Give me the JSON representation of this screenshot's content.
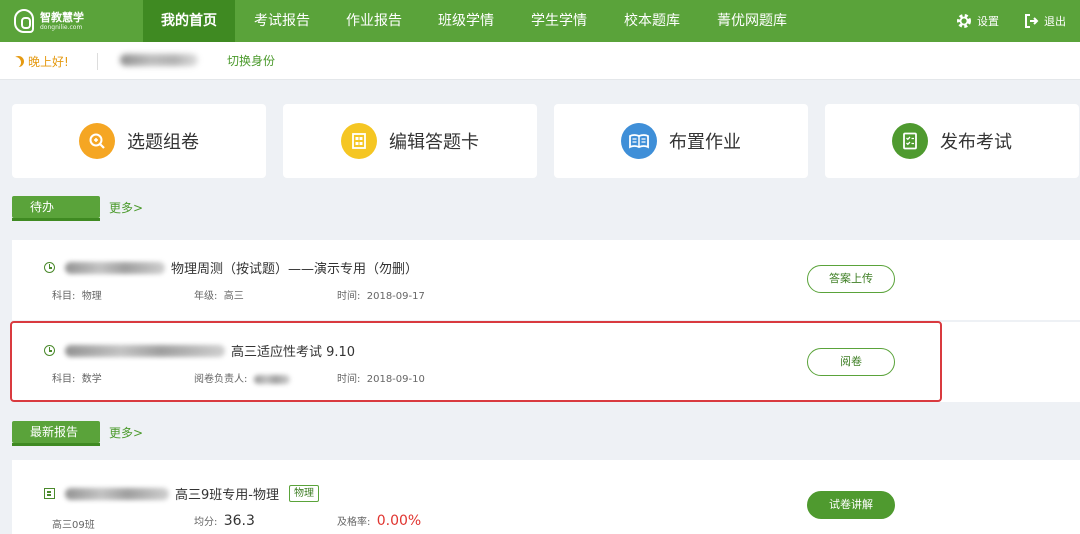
{
  "header": {
    "logo": {
      "cn": "智教慧学",
      "en": "dongnilie.com"
    },
    "nav": [
      "我的首页",
      "考试报告",
      "作业报告",
      "班级学情",
      "学生学情",
      "校本题库",
      "菁优网题库"
    ],
    "active_index": 0,
    "settings_label": "设置",
    "logout_label": "退出"
  },
  "greeting": {
    "text": "晚上好!",
    "switch_role": "切换身份"
  },
  "quick_actions": [
    {
      "label": "选题组卷",
      "icon": "search-paper-icon",
      "color": "#f5a623"
    },
    {
      "label": "编辑答题卡",
      "icon": "answer-card-icon",
      "color": "#f5c623"
    },
    {
      "label": "布置作业",
      "icon": "open-book-icon",
      "color": "#3f8fd8"
    },
    {
      "label": "发布考试",
      "icon": "checklist-icon",
      "color": "#4f9a2f"
    }
  ],
  "todo": {
    "tab": "待办",
    "more": "更多>",
    "items": [
      {
        "title": "物理周测（按试题）——演示专用（勿删）",
        "subject_label": "科目:",
        "subject": "物理",
        "field2_label": "年级:",
        "field2": "高三",
        "time_label": "时间:",
        "time": "2018-09-17",
        "action": "答案上传"
      },
      {
        "title": "高三适应性考试 9.10",
        "subject_label": "科目:",
        "subject": "数学",
        "field2_label": "阅卷负责人:",
        "field2": "",
        "time_label": "时间:",
        "time": "2018-09-10",
        "action": "阅卷"
      }
    ]
  },
  "reports": {
    "tab": "最新报告",
    "more": "更多>",
    "items": [
      {
        "title": "高三9班专用-物理",
        "tag": "物理",
        "class": "高三09班",
        "avg_label": "均分:",
        "avg": "36.3",
        "pass_label": "及格率:",
        "pass": "0.00%",
        "action": "试卷讲解"
      }
    ]
  },
  "colors": {
    "brand": "#5aa33a",
    "brand_dark": "#3f8a22",
    "highlight": "#d93a3f",
    "danger": "#e0342f"
  }
}
